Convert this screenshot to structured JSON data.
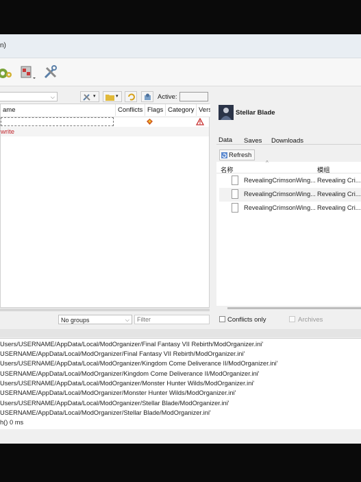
{
  "window": {
    "title_fragment": "n)"
  },
  "toolbar": {
    "active_label": "Active:"
  },
  "left_pane": {
    "columns": [
      "ame",
      "Conflicts",
      "Flags",
      "Category",
      "Versi"
    ],
    "overwrite_label": "write",
    "groups_select": "No groups",
    "filter_placeholder": "Filter"
  },
  "right_pane": {
    "game_name": "Stellar Blade",
    "tabs": [
      "Data",
      "Saves",
      "Downloads"
    ],
    "refresh_label": "Refresh",
    "columns": [
      "名称",
      "模组"
    ],
    "files": [
      {
        "name": "RevealingCrimsonWing...",
        "mod": "Revealing Cri..."
      },
      {
        "name": "RevealingCrimsonWing...",
        "mod": "Revealing Cri..."
      },
      {
        "name": "RevealingCrimsonWing...",
        "mod": "Revealing Cri..."
      }
    ],
    "conflicts_only_label": "Conflicts only",
    "archives_label": "Archives"
  },
  "log": {
    "lines": [
      "Users/USERNAME/AppData/Local/ModOrganizer/Final Fantasy VII Rebirth/ModOrganizer.ini'",
      "USERNAME/AppData/Local/ModOrganizer/Final Fantasy VII Rebirth/ModOrganizer.ini'",
      "Users/USERNAME/AppData/Local/ModOrganizer/Kingdom Come Deliverance II/ModOrganizer.ini'",
      "USERNAME/AppData/Local/ModOrganizer/Kingdom Come Deliverance II/ModOrganizer.ini'",
      "Users/USERNAME/AppData/Local/ModOrganizer/Monster Hunter Wilds/ModOrganizer.ini'",
      "USERNAME/AppData/Local/ModOrganizer/Monster Hunter Wilds/ModOrganizer.ini'",
      "Users/USERNAME/AppData/Local/ModOrganizer/Stellar Blade/ModOrganizer.ini'",
      "USERNAME/AppData/Local/ModOrganizer/Stellar Blade/ModOrganizer.ini'",
      "h() 0 ms"
    ]
  }
}
